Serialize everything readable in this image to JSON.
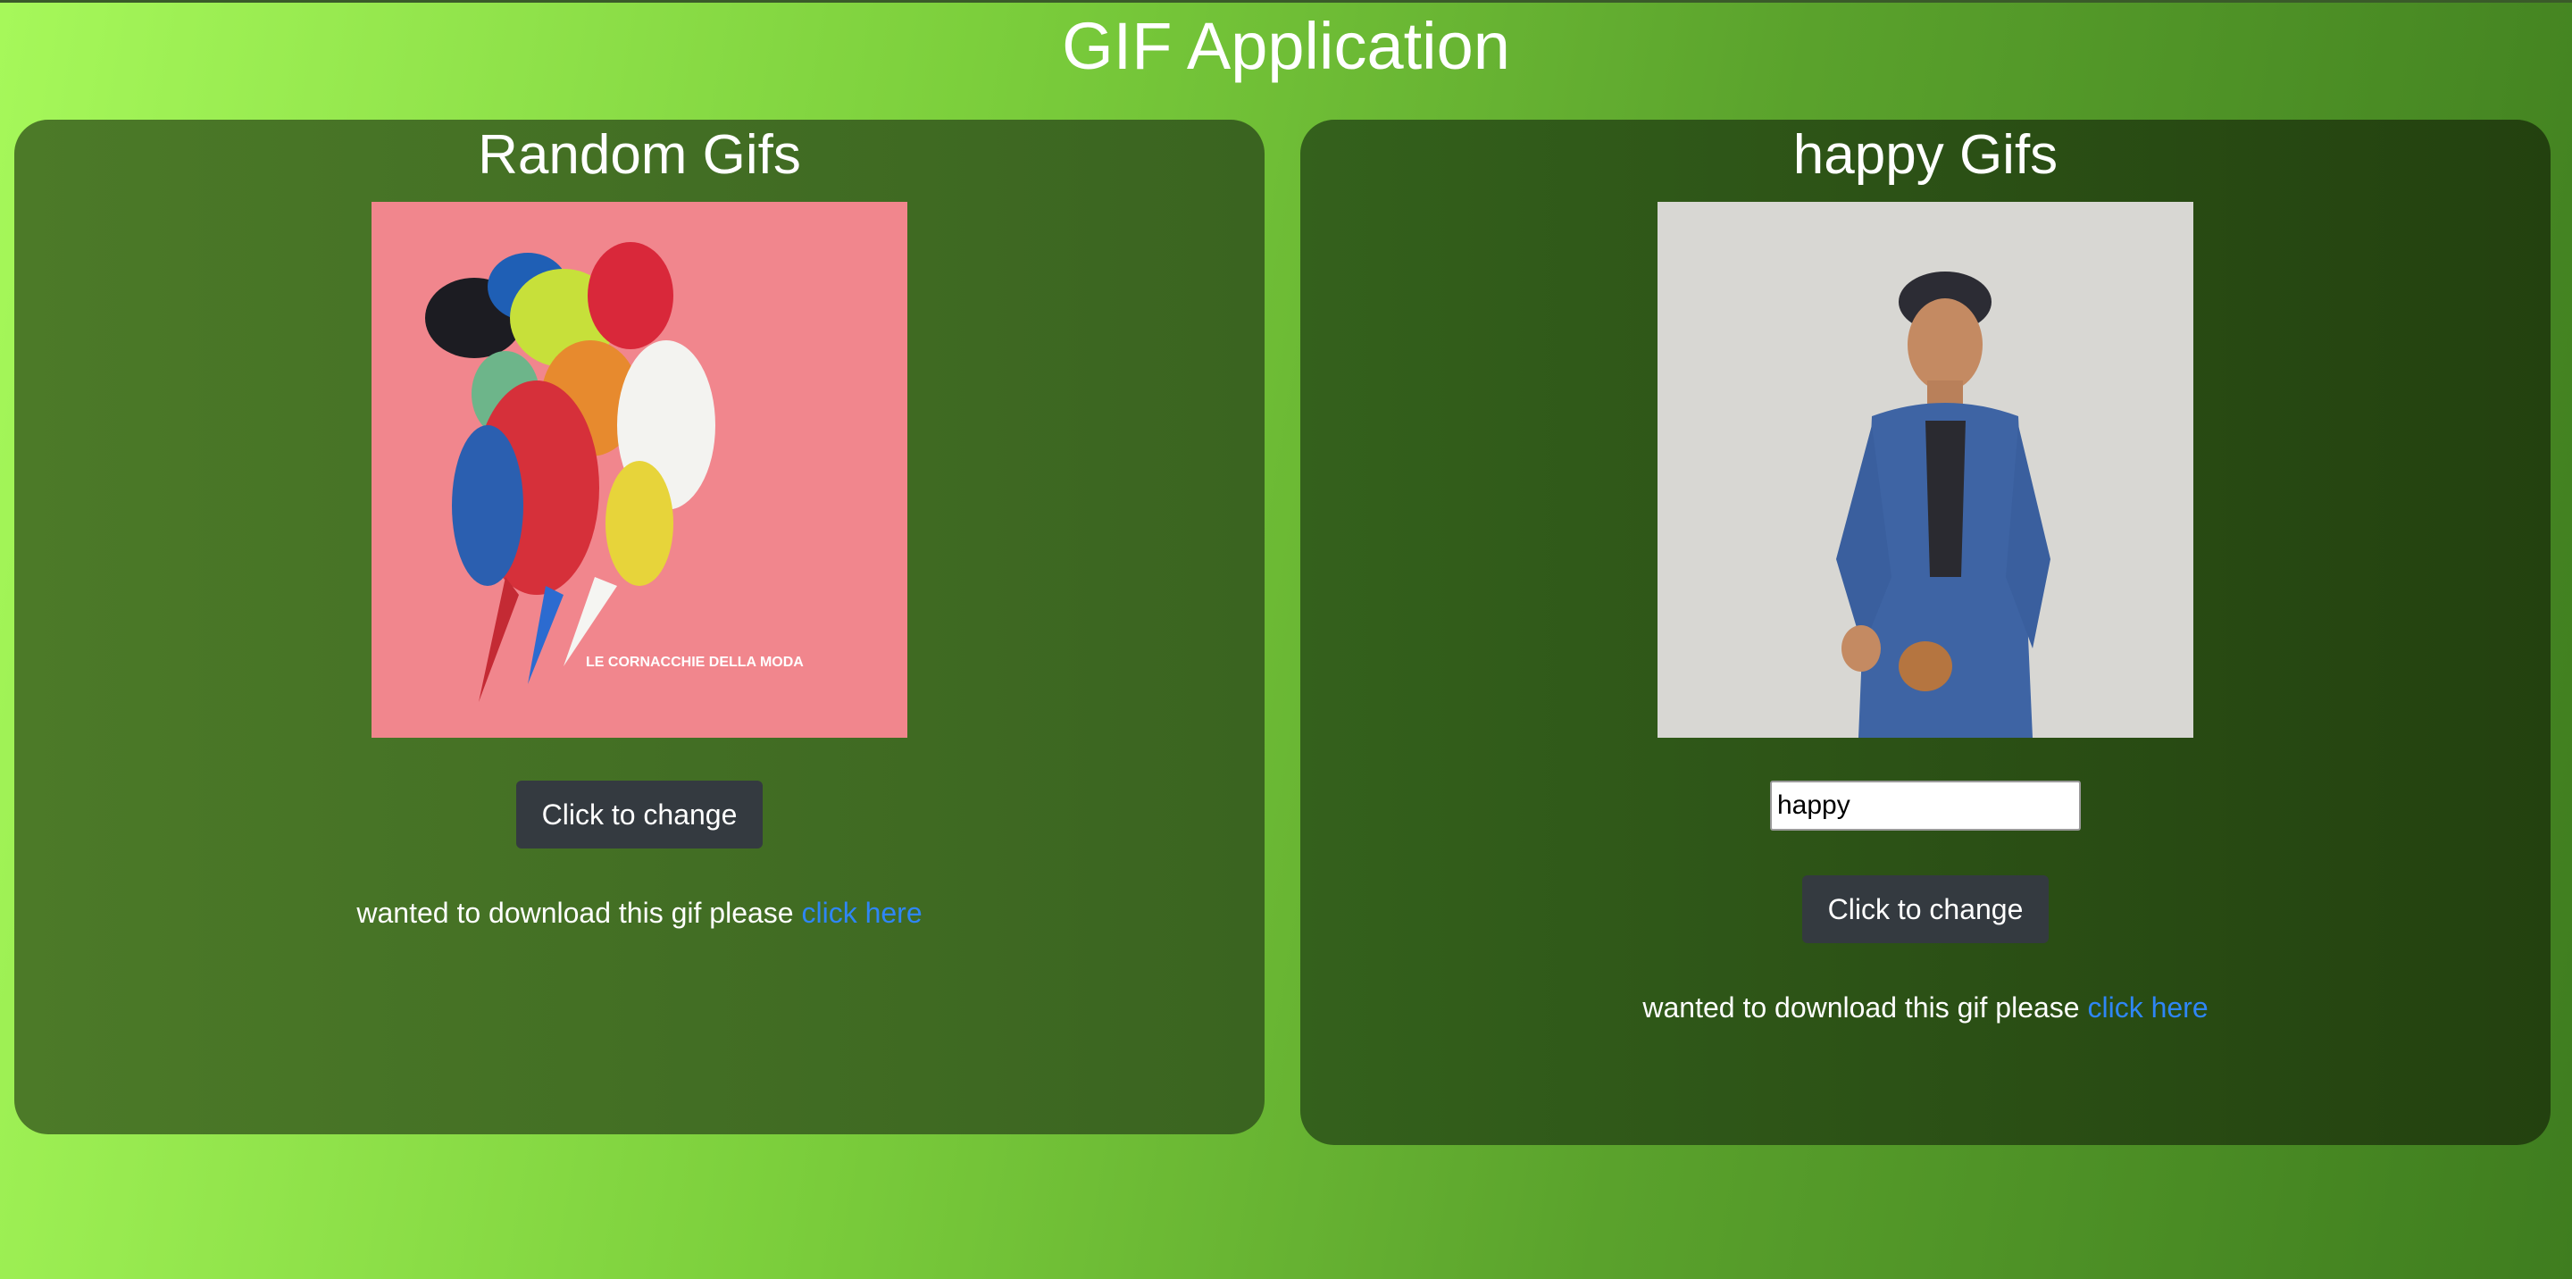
{
  "app": {
    "title": "GIF Application"
  },
  "random_card": {
    "title": "Random Gifs",
    "gif_caption": "LE CORNACCHIE DELLA MODA",
    "button_label": "Click to change",
    "download_text": "wanted to download this gif please ",
    "download_link": "click here"
  },
  "tag_card": {
    "title": "happy Gifs",
    "input_value": "happy",
    "button_label": "Click to change",
    "download_text": "wanted to download this gif please ",
    "download_link": "click here"
  },
  "colors": {
    "page_gradient_start": "#a6f85a",
    "page_gradient_end": "#3f7d1f",
    "card_left": "#4c7a28",
    "card_right": "#23410f",
    "button_bg": "#343a40",
    "link": "#2f86f6"
  }
}
